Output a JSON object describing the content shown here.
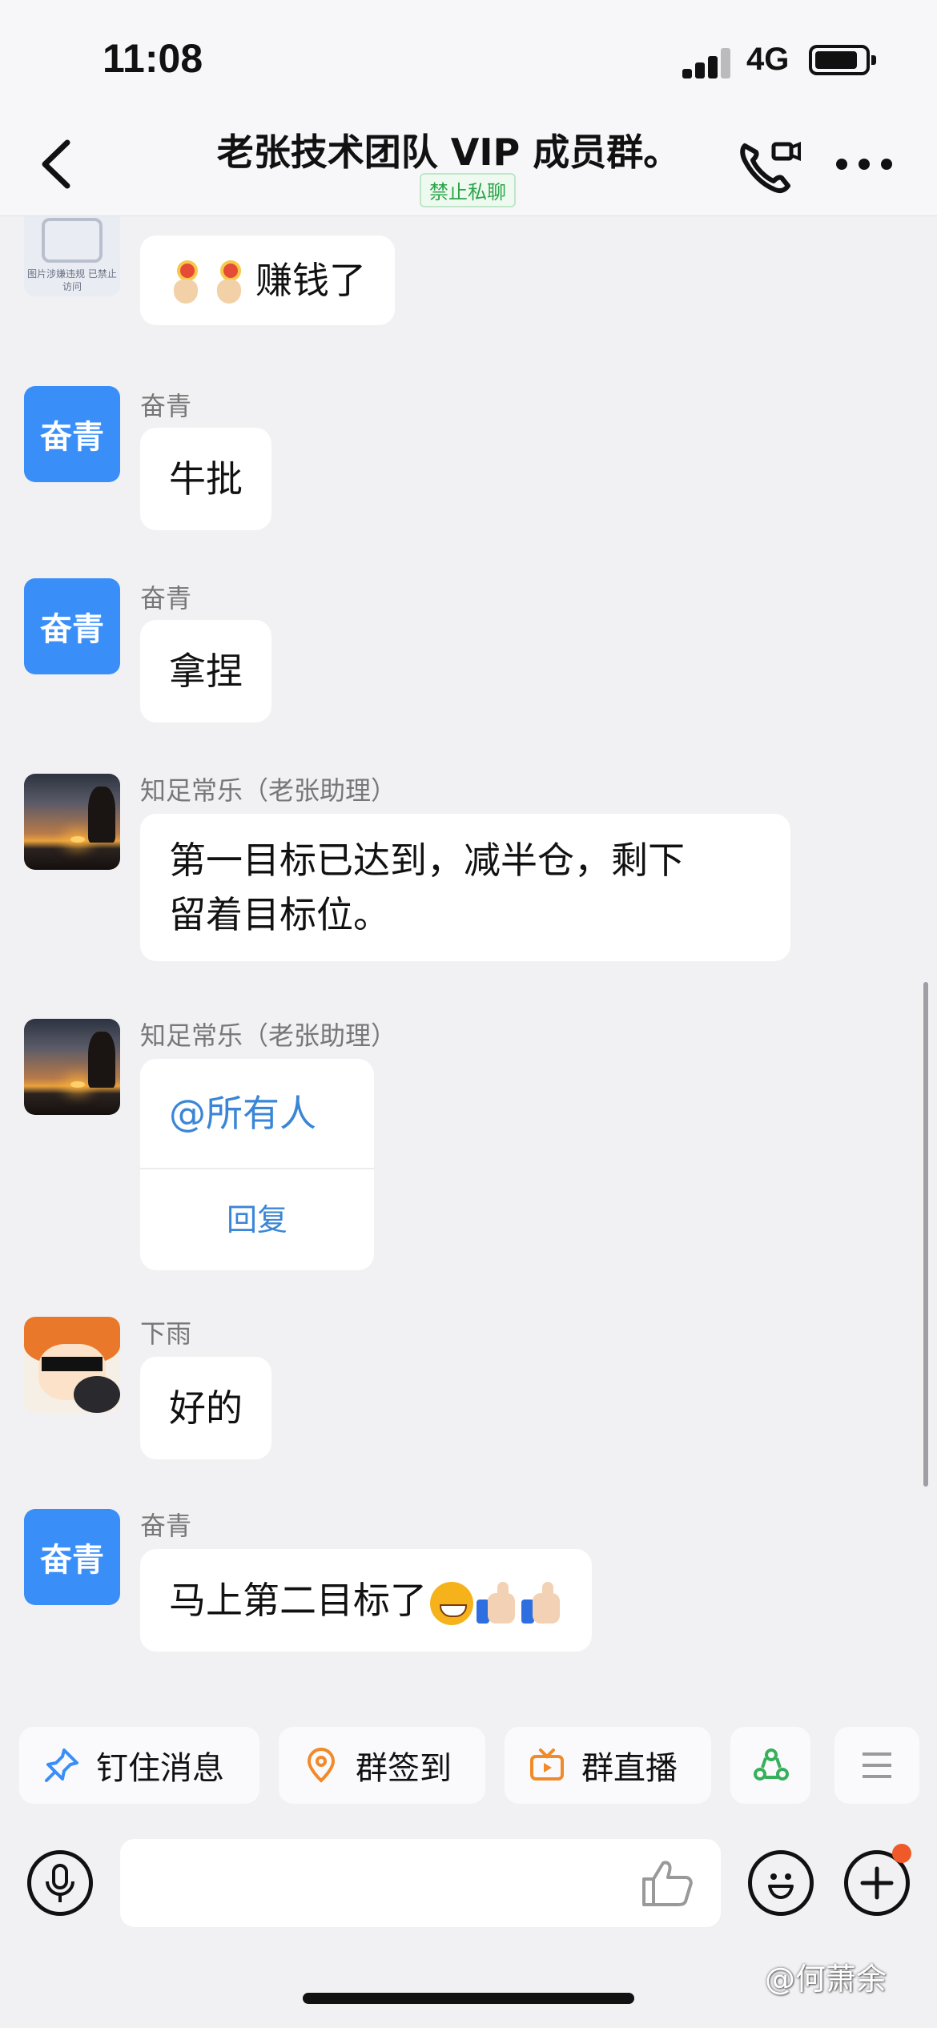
{
  "status_bar": {
    "time": "11:08",
    "network": "4G"
  },
  "header": {
    "title": "老张技术团队 VIP 成员群。",
    "badge": "禁止私聊"
  },
  "messages": [
    {
      "sender": "",
      "avatar_text": "图片涉嫌违规 已禁止访问",
      "text": "赚钱了"
    },
    {
      "sender": "奋青",
      "avatar_text": "奋青",
      "text": "牛批"
    },
    {
      "sender": "奋青",
      "avatar_text": "奋青",
      "text": "拿捏"
    },
    {
      "sender": "知足常乐（老张助理）",
      "text_line1": "第一目标已达到，减半仓，剩下",
      "text_line2": "留着目标位。"
    },
    {
      "sender": "知足常乐（老张助理）",
      "mention": "@所有人",
      "action": "回复"
    },
    {
      "sender": "下雨",
      "text": "好的"
    },
    {
      "sender": "奋青",
      "avatar_text": "奋青",
      "text": "马上第二目标了"
    }
  ],
  "quick_actions": [
    {
      "label": "钉住消息",
      "icon": "pin-icon"
    },
    {
      "label": "群签到",
      "icon": "location-icon"
    },
    {
      "label": "群直播",
      "icon": "tv-icon"
    },
    {
      "label": "",
      "icon": "recycle-icon"
    }
  ],
  "input": {
    "placeholder": ""
  },
  "watermark": "@何萧余",
  "colors": {
    "accent_blue": "#3a8ef8",
    "link_blue": "#3a86d6",
    "badge_green": "#2aa44a",
    "notify_red": "#f05a28"
  }
}
